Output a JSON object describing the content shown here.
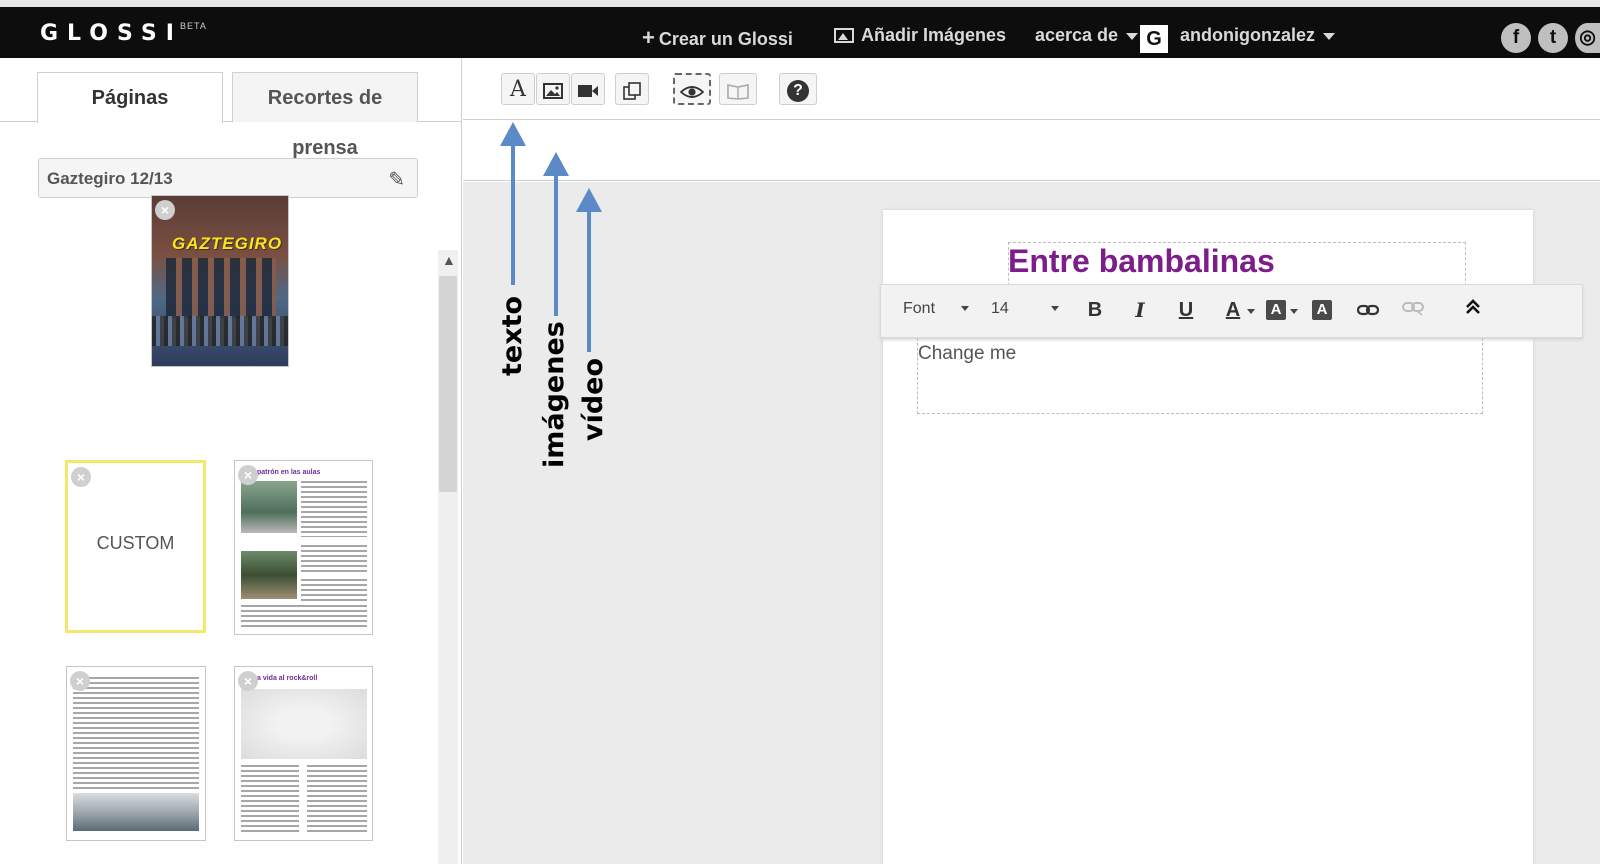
{
  "navbar": {
    "logo": "GLOSSI",
    "beta": "BETA",
    "create_label": "Crear un Glossi",
    "add_images_label": "Añadir Imágenes",
    "about_label": "acerca de",
    "user_avatar_letter": "G",
    "username": "andonigonzalez",
    "social_icons": [
      "facebook-icon",
      "twitter-icon",
      "instagram-icon"
    ],
    "social_letters": [
      "f",
      "t",
      "◎"
    ]
  },
  "left_panel": {
    "tabs": [
      {
        "label": "Páginas",
        "active": true
      },
      {
        "label": "Recortes de prensa",
        "active": false
      }
    ],
    "book_title": "Gaztegiro 12/13",
    "cover": {
      "title": "GAZTEGIRO"
    },
    "custom_label": "CUSTOM",
    "thumb_headings": [
      "patrón en las aulas",
      "a vida al rock&roll"
    ]
  },
  "toolbar": {
    "buttons": [
      {
        "name": "text-tool-button",
        "icon": "A",
        "active": false
      },
      {
        "name": "image-tool-button",
        "icon": "image-icon",
        "active": false
      },
      {
        "name": "video-tool-button",
        "icon": "video-icon",
        "active": false
      },
      {
        "name": "duplicate-button",
        "icon": "copy-icon",
        "active": false
      },
      {
        "name": "preview-button",
        "icon": "eye-icon",
        "active": true
      },
      {
        "name": "book-view-button",
        "icon": "book-icon",
        "active": false
      },
      {
        "name": "help-button",
        "icon": "?",
        "active": false
      }
    ]
  },
  "editor": {
    "heading": "Entre bambalinas",
    "body_text": "Change me",
    "rte": {
      "font_label": "Font",
      "size_label": "14",
      "bold": "B",
      "italic": "I",
      "underline": "U",
      "font_color": "A",
      "bg_color": "A",
      "clear_format": "A"
    }
  },
  "annotations": {
    "texto": "texto",
    "imagenes": "imágenes",
    "video": "vídeo"
  },
  "colors": {
    "heading": "#7d1d8b",
    "arrow": "#5b8ac6",
    "navbar_bg": "#0d0d0d",
    "custom_border": "#f4e86c"
  }
}
